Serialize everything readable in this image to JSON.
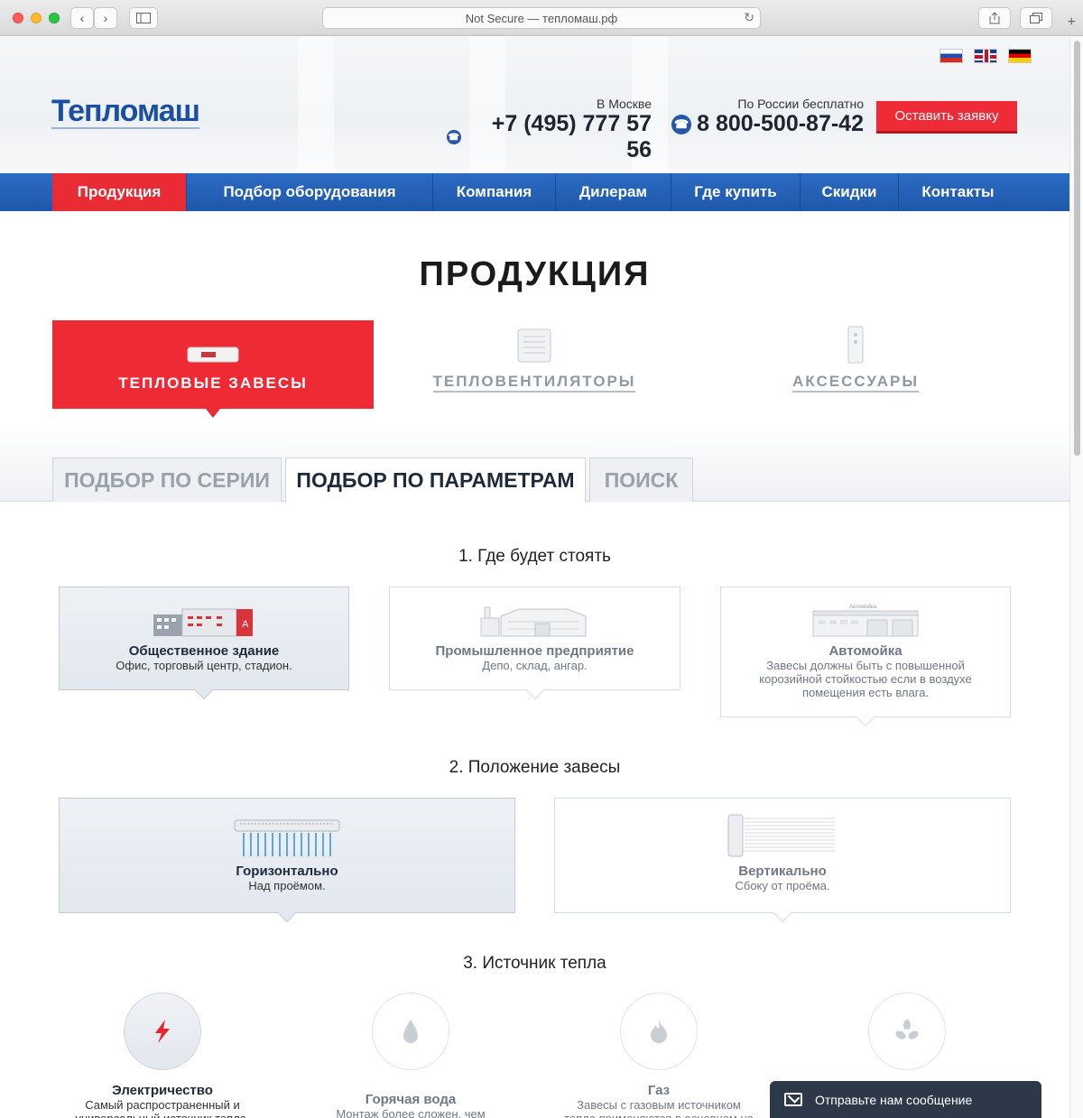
{
  "browser": {
    "url": "Not Secure — тепломаш.рф",
    "back": "‹",
    "forward": "›",
    "new_tab": "+"
  },
  "header": {
    "logo": "Тепломаш",
    "flags": [
      "russian-flag",
      "english-flag",
      "german-flag"
    ],
    "moscow_label": "В Москве",
    "moscow_phone": "+7 (495) 777 57 56",
    "russia_label": "По России бесплатно",
    "russia_phone": "8 800-500-87-42",
    "cta": "Оставить заявку"
  },
  "nav": {
    "items": [
      {
        "label": "Продукция",
        "active": true
      },
      {
        "label": "Подбор оборудования",
        "active": false
      },
      {
        "label": "Компания",
        "active": false
      },
      {
        "label": "Дилерам",
        "active": false
      },
      {
        "label": "Где купить",
        "active": false
      },
      {
        "label": "Скидки",
        "active": false
      },
      {
        "label": "Контакты",
        "active": false
      }
    ]
  },
  "main": {
    "title": "ПРОДУКЦИЯ",
    "categories": [
      {
        "label": "ТЕПЛОВЫЕ ЗАВЕСЫ",
        "active": true,
        "icon": "heat-curtain-icon"
      },
      {
        "label": "ТЕПЛОВЕНТИЛЯТОРЫ",
        "active": false,
        "icon": "fan-heater-icon"
      },
      {
        "label": "АКСЕССУАРЫ",
        "active": false,
        "icon": "remote-control-icon"
      }
    ],
    "tabs": [
      {
        "label": "ПОДБОР ПО СЕРИИ",
        "active": false
      },
      {
        "label": "ПОДБОР ПО ПАРАМЕТРАМ",
        "active": true
      },
      {
        "label": "ПОИСК",
        "active": false
      }
    ]
  },
  "location": {
    "title": "1. Где будет стоять",
    "options": [
      {
        "title": "Общественное здание",
        "desc": "Офис, торговый центр, стадион.",
        "selected": true,
        "icon": "public-building-icon"
      },
      {
        "title": "Промышленное предприятие",
        "desc": "Депо, склад, ангар.",
        "selected": false,
        "icon": "factory-icon"
      },
      {
        "title": "Автомойка",
        "desc": "Завесы должны быть с повышенной корозийной стойкостью если в воздухе помещения есть влага.",
        "selected": false,
        "icon": "car-wash-icon",
        "sign": "Автомойка"
      }
    ]
  },
  "position": {
    "title": "2. Положение завесы",
    "options": [
      {
        "title": "Горизонтально",
        "desc": "Над проёмом.",
        "selected": true,
        "icon": "horizontal-curtain-icon"
      },
      {
        "title": "Вертикально",
        "desc": "Сбоку от проёма.",
        "selected": false,
        "icon": "vertical-curtain-icon"
      }
    ]
  },
  "heat_source": {
    "title": "3. Источник тепла",
    "options": [
      {
        "title": "Электричество",
        "desc": "Самый распространенный и универсальный источник тепла.",
        "selected": true,
        "icon": "lightning-icon"
      },
      {
        "title": "Горячая вода",
        "desc": "Монтаж более сложен, чем",
        "selected": false,
        "icon": "water-drop-icon"
      },
      {
        "title": "Газ",
        "desc": "Завесы с газовым источником тепла применяются в основном на крупных",
        "selected": false,
        "icon": "flame-icon"
      },
      {
        "title": "",
        "desc": "",
        "selected": false,
        "icon": "fan-icon"
      }
    ]
  },
  "chat": {
    "label": "Отправьте нам сообщение"
  },
  "colors": {
    "brand_blue": "#1f58aa",
    "accent_red": "#ee2a35"
  }
}
